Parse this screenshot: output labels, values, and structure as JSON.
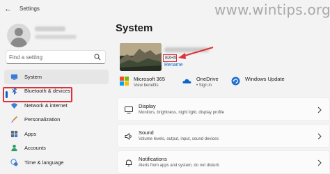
{
  "titlebar": {
    "app_title": "Settings",
    "back_glyph": "←",
    "watermark": "www.wintips.org"
  },
  "sidebar": {
    "search": {
      "placeholder": "Find a setting",
      "value": ""
    },
    "items": [
      {
        "label": "System",
        "icon": "system-icon",
        "active": true
      },
      {
        "label": "Bluetooth & devices",
        "icon": "bluetooth-icon"
      },
      {
        "label": "Network & internet",
        "icon": "wifi-icon"
      },
      {
        "label": "Personalization",
        "icon": "brush-icon"
      },
      {
        "label": "Apps",
        "icon": "apps-icon"
      },
      {
        "label": "Accounts",
        "icon": "person-icon"
      },
      {
        "label": "Time & language",
        "icon": "clock-globe-icon"
      }
    ]
  },
  "main": {
    "title": "System",
    "device": {
      "model": "82H5",
      "rename_label": "Rename"
    },
    "quick": [
      {
        "title": "Microsoft 365",
        "sub": "View benefits",
        "icon": "microsoft-365-icon"
      },
      {
        "title": "OneDrive",
        "sub": "• Sign in",
        "icon": "onedrive-icon"
      },
      {
        "title": "Windows Update",
        "sub": "",
        "icon": "windows-update-icon"
      }
    ],
    "cards": [
      {
        "title": "Display",
        "sub": "Monitors, brightness, night light, display profile",
        "icon": "display-icon"
      },
      {
        "title": "Sound",
        "sub": "Volume levels, output, input, sound devices",
        "icon": "sound-icon"
      },
      {
        "title": "Notifications",
        "sub": "Alerts from apps and system, do not disturb",
        "icon": "bell-icon"
      }
    ]
  },
  "colors": {
    "accent": "#0067c0",
    "annotation": "#e0323a",
    "background": "#f3f3f3"
  }
}
